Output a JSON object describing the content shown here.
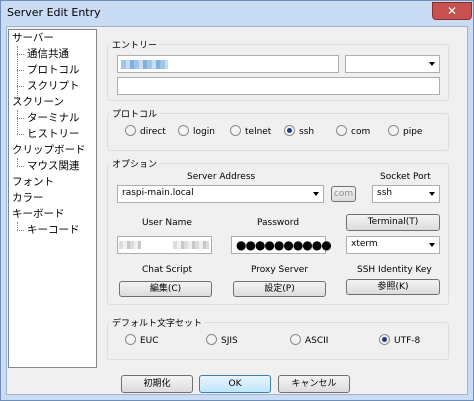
{
  "window": {
    "title": "Server Edit Entry",
    "close_glyph": "✕"
  },
  "tree": {
    "items": [
      {
        "label": "サーバー",
        "level": 0
      },
      {
        "label": "通信共通",
        "level": 1
      },
      {
        "label": "プロトコル",
        "level": 1
      },
      {
        "label": "スクリプト",
        "level": 1
      },
      {
        "label": "スクリーン",
        "level": 0
      },
      {
        "label": "ターミナル",
        "level": 1
      },
      {
        "label": "ヒストリー",
        "level": 1
      },
      {
        "label": "クリップボード",
        "level": 0
      },
      {
        "label": "マウス関連",
        "level": 1
      },
      {
        "label": "フォント",
        "level": 0
      },
      {
        "label": "カラー",
        "level": 0
      },
      {
        "label": "キーボード",
        "level": 0
      },
      {
        "label": "キーコード",
        "level": 1
      }
    ]
  },
  "entry": {
    "legend": "エントリー"
  },
  "protocol": {
    "legend": "プロトコル",
    "options": [
      "direct",
      "login",
      "telnet",
      "ssh",
      "com",
      "pipe"
    ],
    "selected": "ssh"
  },
  "options": {
    "legend": "オプション",
    "server_address_label": "Server Address",
    "server_address_value": "raspi-main.local",
    "com_button": "com",
    "socket_port_label": "Socket Port",
    "socket_port_value": "ssh",
    "user_name_label": "User Name",
    "password_label": "Password",
    "password_dots": "●●●●●●●●●●",
    "terminal_button": "Terminal(T)",
    "terminal_type_value": "xterm",
    "chat_script_label": "Chat Script",
    "chat_script_button": "編集(C)",
    "proxy_server_label": "Proxy Server",
    "proxy_server_button": "設定(P)",
    "ssh_key_label": "SSH Identity Key",
    "ssh_key_button": "参照(K)"
  },
  "charset": {
    "legend": "デフォルト文字セット",
    "options": [
      "EUC",
      "SJIS",
      "ASCII",
      "UTF-8"
    ],
    "selected": "UTF-8"
  },
  "footer": {
    "reset_button": "初期化",
    "ok_button": "OK",
    "cancel_button": "キャンセル"
  }
}
